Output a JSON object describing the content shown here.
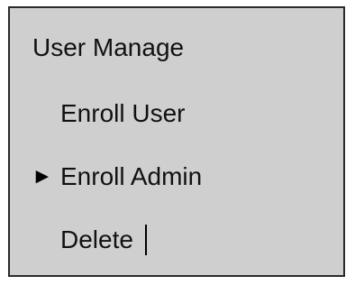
{
  "screen": {
    "title": "User Manage",
    "menu": {
      "items": [
        {
          "label": "Enroll User",
          "selected": false,
          "pointer": ""
        },
        {
          "label": "Enroll Admin",
          "selected": true,
          "pointer": "►"
        },
        {
          "label": "Delete",
          "selected": false,
          "pointer": ""
        }
      ]
    },
    "colors": {
      "background": "#cfcfcf",
      "text": "#111111",
      "border": "#2a2a2a"
    }
  }
}
